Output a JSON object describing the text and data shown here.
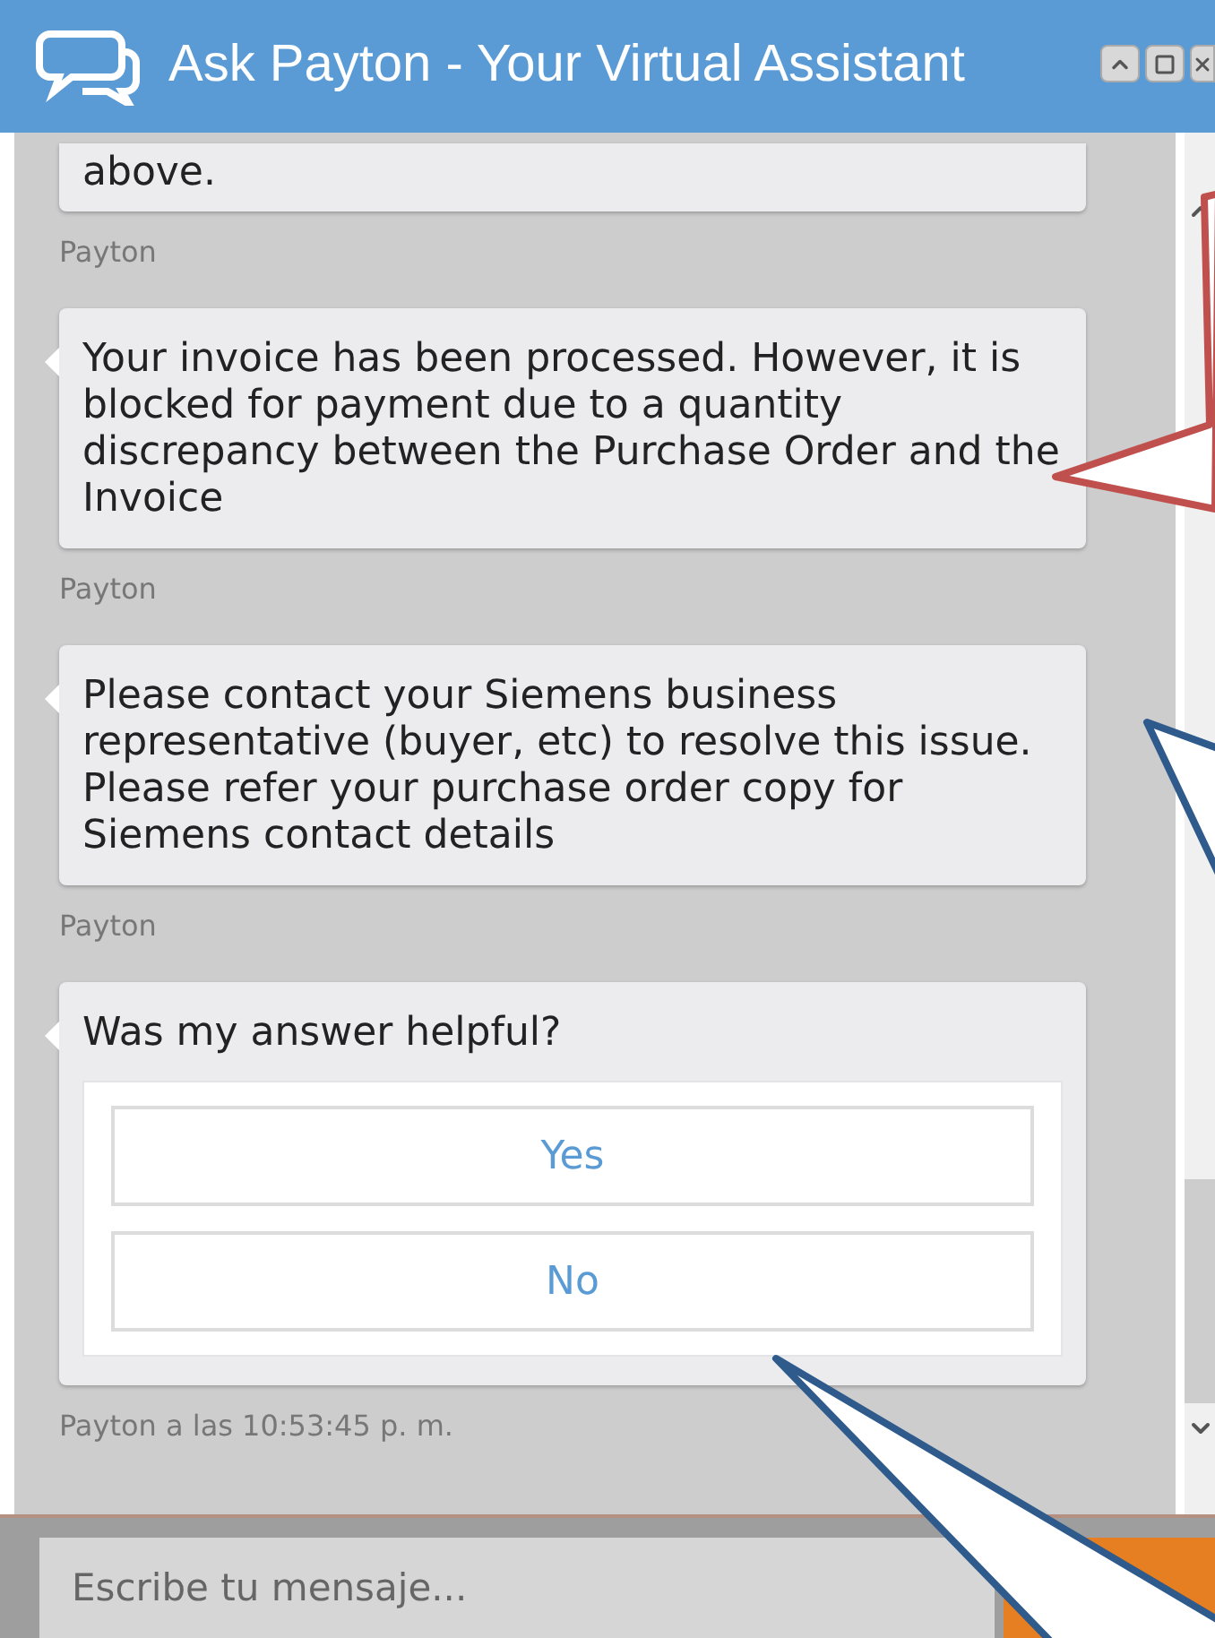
{
  "window": {
    "title": "Ask Payton - Your Virtual Assistant"
  },
  "messages": [
    {
      "kind": "text",
      "text": "above.",
      "sender": "Payton"
    },
    {
      "kind": "text",
      "text": "Your invoice has been processed. However, it is blocked for payment due to a quantity discrepancy between the Purchase Order and the Invoice",
      "sender": "Payton"
    },
    {
      "kind": "text",
      "text": "Please contact your Siemens business representative (buyer, etc) to resolve this issue. Please refer your purchase order copy for Siemens contact details",
      "sender": "Payton"
    },
    {
      "kind": "feedback",
      "text": "Was my answer helpful?",
      "options": [
        "Yes",
        "No"
      ],
      "sender": "Payton a las 10:53:45 p. m."
    }
  ],
  "composer": {
    "placeholder": "Escribe tu mensaje..."
  }
}
